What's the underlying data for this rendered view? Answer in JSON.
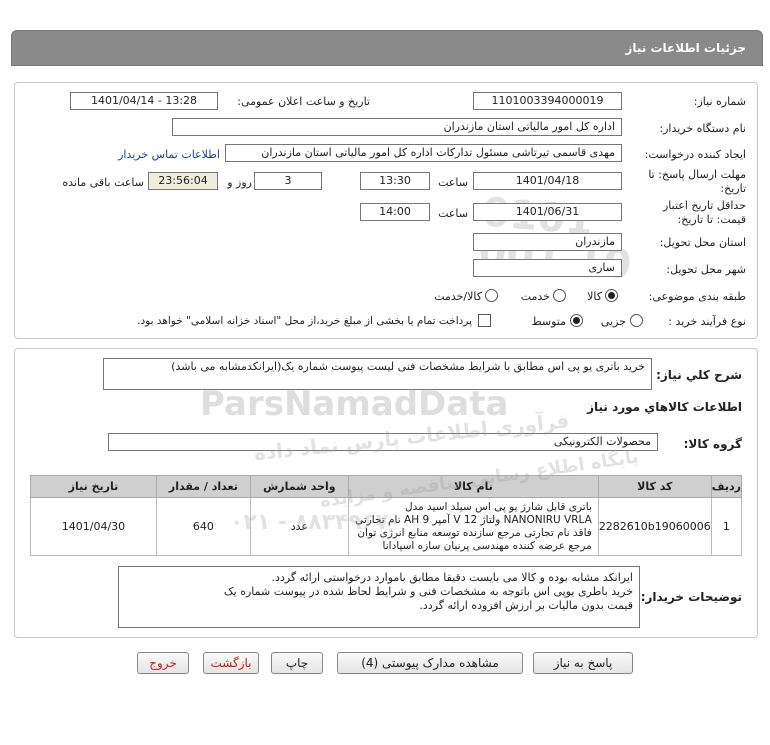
{
  "header": {
    "title": "جزئیات اطلاعات نیاز"
  },
  "form": {
    "need_number": {
      "label": "شماره نیاز:",
      "value": "1101003394000019"
    },
    "announce": {
      "label": "تاریخ و ساعت اعلان عمومی:",
      "value": "1401/04/14 - 13:28"
    },
    "buyer_org": {
      "label": "نام دستگاه خریدار:",
      "value": "اداره کل امور مالیاتی استان مازندران"
    },
    "requester": {
      "label": "ایجاد کننده درخواست:",
      "value": "مهدی قاسمی تیرتاشی مسئول تدارکات اداره کل امور مالیاتی استان مازندران",
      "contact_link": "اطلاعات تماس خریدار"
    },
    "deadline": {
      "label": "مهلت ارسال پاسخ: تا تاریخ:",
      "date": "1401/04/18",
      "time_label": "ساعت",
      "time": "13:30",
      "days": "3",
      "days_label": "روز و",
      "remaining": "23:56:04",
      "remaining_label": "ساعت باقی مانده"
    },
    "validity": {
      "label": "حداقل تاریخ اعتبار قیمت: تا تاریخ:",
      "date": "1401/06/31",
      "time_label": "ساعت",
      "time": "14:00"
    },
    "province": {
      "label": "استان محل تحویل:",
      "value": "مازندران"
    },
    "city": {
      "label": "شهر محل تحویل:",
      "value": "ساری"
    },
    "category": {
      "label": "طبقه بندی موضوعی:",
      "options": [
        "کالا",
        "خدمت",
        "کالا/خدمت"
      ],
      "selected": "کالا"
    },
    "process": {
      "label": "نوع فرآیند خرید :",
      "options": [
        "جزیی",
        "متوسط"
      ],
      "selected": "متوسط",
      "treasury_note": "پرداخت تمام یا بخشی از مبلغ خرید،از محل \"اسناد خزانه اسلامی\" خواهد بود."
    }
  },
  "summary": {
    "label": "شرح کلي نياز:",
    "value": "خرید باتری یو پی اس مطابق با شرایط مشخصات فنی لیست پیوست شماره یک(ایرانکدمشابه می باشد)"
  },
  "goods": {
    "section_title": "اطلاعات کالاهاي مورد نياز",
    "group_label": "گروه کالا:",
    "group_value": "محصولات الکترونیکی",
    "columns": [
      "ردیف",
      "کد کالا",
      "نام کالا",
      "واحد شمارش",
      "تعداد / مقدار",
      "تاریخ نیاز"
    ],
    "rows": [
      {
        "index": "1",
        "code": "2282610b19060006",
        "name": "باتری قابل شارژ یو پی اس سیلد اسید مدل NANONIRU VRLA ولتاژ 12 V آمپر 9 AH نام تجارتی فاقد نام تجارتی مرجع سازنده توسعه منابع انرژی توان مرجع عرضه کننده مهندسی پرنیان سازه اسپادانا",
        "unit": "عدد",
        "qty": "640",
        "date": "1401/04/30"
      }
    ]
  },
  "buyer_notes": {
    "label": "توضیحات خریدار:",
    "lines": [
      "ایرانکد مشابه بوده و کالا می بایست دقیقا مطابق باموارد درخواستی ارائه گردد.",
      "خرید باطری یوپی اس باتوجه به مشخصات فنی و شرایط لحاظ شده در پیوست شماره یک",
      "قیمت بدون مالیات بر ارزش افزوده ارائه گردد."
    ]
  },
  "buttons": {
    "reply": "پاسخ به نیاز",
    "view_docs": "مشاهده مدارک پیوستی (4)",
    "print": "چاپ",
    "back": "بازگشت",
    "exit": "خروج"
  },
  "watermark": {
    "brand": "ParsNamadData",
    "line1": "پایگاه اطلاع رسانی مناقصه و مزایده",
    "line2": "فرآوری اطلاعات پارس نماد داده",
    "phone": "۰۲۱ - ۸۸۳۴۹۶۷۰",
    "logo_digits": "0101 001 10"
  }
}
